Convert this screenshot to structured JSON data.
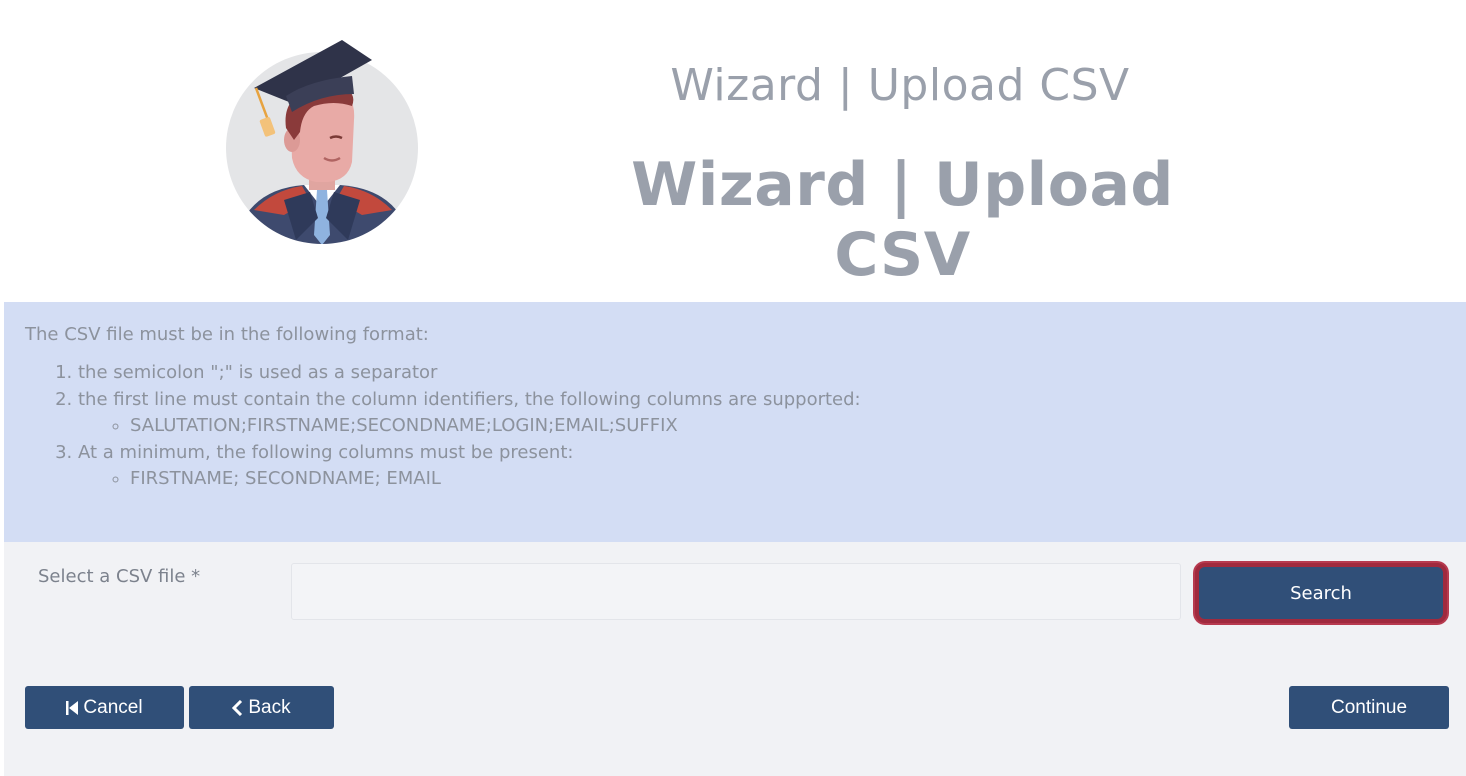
{
  "header": {
    "title_small": "Wizard | Upload CSV",
    "title_large": "Wizard | Upload CSV",
    "avatar_icon": "graduate-avatar-icon"
  },
  "info": {
    "intro": "The CSV file must be in the following format:",
    "items": [
      {
        "text": "the semicolon \";\" is used as a separator"
      },
      {
        "text": "the first line must contain the column identifiers, the following columns are supported:",
        "sub": "SALUTATION;FIRSTNAME;SECONDNAME;LOGIN;EMAIL;SUFFIX"
      },
      {
        "text": "At a minimum, the following columns must be present:",
        "sub": "FIRSTNAME; SECONDNAME; EMAIL"
      }
    ]
  },
  "form": {
    "file_label": "Select a CSV file *",
    "file_value": "",
    "search_label": "Search"
  },
  "buttons": {
    "cancel": "Cancel",
    "back": "Back",
    "continue": "Continue"
  },
  "colors": {
    "primary": "#304f78",
    "highlight": "#a02a3e",
    "info_bg": "#d3ddf4",
    "form_bg": "#f1f2f5"
  }
}
